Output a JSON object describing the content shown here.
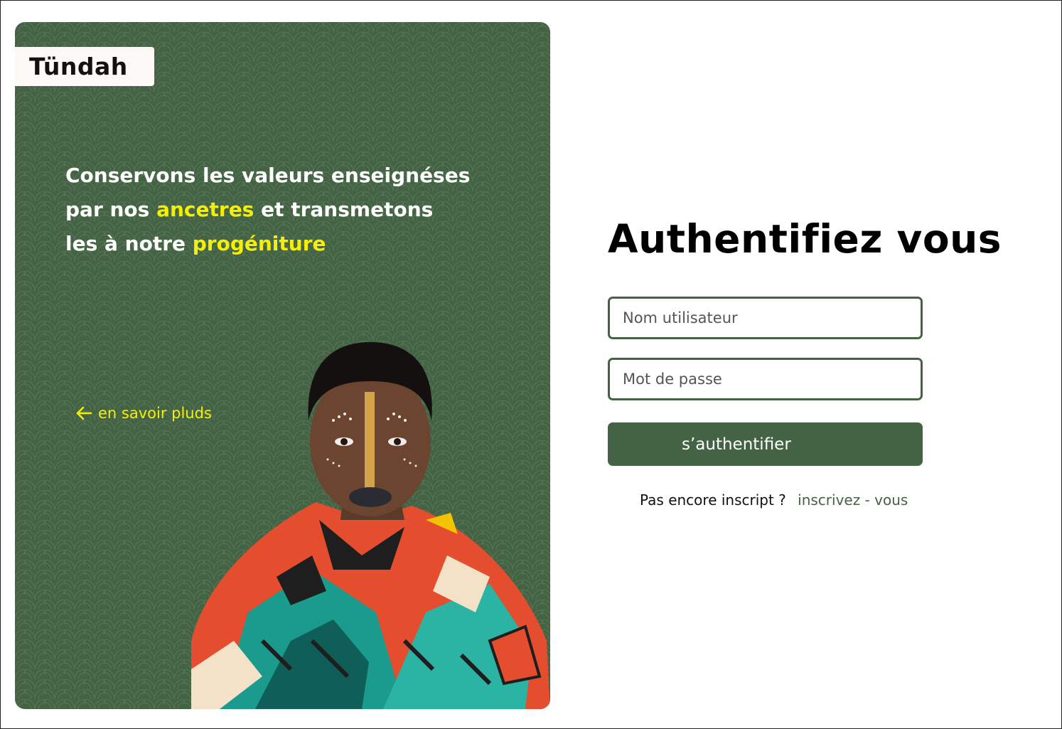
{
  "brand": {
    "name": "Tündah"
  },
  "hero": {
    "tagline": {
      "part1": "Conservons les valeurs enseignéses",
      "part2": "par nos ",
      "highlight1": "ancetres",
      "part3": " et transmetons",
      "part4": "les à notre ",
      "highlight2": "progéniture"
    },
    "learn_more_label": "en savoir pluds",
    "learn_more_icon": "arrow-left-icon"
  },
  "auth": {
    "title": "Authentifiez vous",
    "username_placeholder": "Nom utilisateur",
    "username_value": "",
    "password_placeholder": "Mot de passe",
    "password_value": "",
    "submit_label": "s’authentifier",
    "signup_prompt": "Pas encore inscript ?",
    "signup_link": "inscrivez - vous"
  },
  "colors": {
    "primary_green": "#446344",
    "highlight_yellow": "#f6f000",
    "logo_background": "#fbf8f5"
  }
}
